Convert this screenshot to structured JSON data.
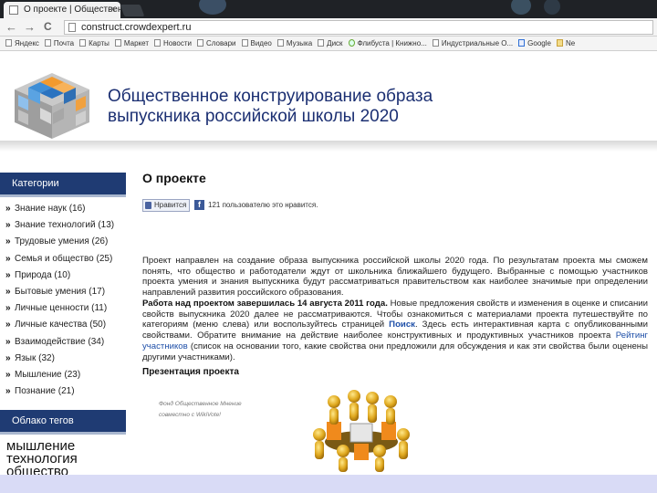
{
  "browser": {
    "tab_title": "О проекте | Общественн",
    "tab_close": "×",
    "url": "construct.crowdexpert.ru",
    "back": "←",
    "forward": "→",
    "reload": "C"
  },
  "bookmarks": [
    {
      "label": "Яндекс",
      "icon": "page-icon"
    },
    {
      "label": "Почта",
      "icon": "page-icon"
    },
    {
      "label": "Карты",
      "icon": "page-icon"
    },
    {
      "label": "Маркет",
      "icon": "page-icon"
    },
    {
      "label": "Новости",
      "icon": "page-icon"
    },
    {
      "label": "Словари",
      "icon": "page-icon"
    },
    {
      "label": "Видео",
      "icon": "page-icon"
    },
    {
      "label": "Музыка",
      "icon": "page-icon"
    },
    {
      "label": "Диск",
      "icon": "page-icon"
    },
    {
      "label": "Флибуста | Книжно...",
      "icon": "flibusta-icon"
    },
    {
      "label": "Индустриальные О...",
      "icon": "page-icon"
    },
    {
      "label": "Google",
      "icon": "google-icon"
    },
    {
      "label": "Ne",
      "icon": "folder-icon"
    }
  ],
  "site": {
    "title_line1": "Общественное конструирование образа",
    "title_line2": "выпускника российской школы 2020"
  },
  "sidebar": {
    "categories_heading": "Категории",
    "bullet": "»",
    "categories": [
      {
        "label": "Знание наук (16)"
      },
      {
        "label": "Знание технологий (13)"
      },
      {
        "label": "Трудовые умения (26)"
      },
      {
        "label": "Семья и общество (25)"
      },
      {
        "label": "Природа (10)"
      },
      {
        "label": "Бытовые умения (17)"
      },
      {
        "label": "Личные ценности (11)"
      },
      {
        "label": "Личные качества (50)"
      },
      {
        "label": "Взаимодействие (34)"
      },
      {
        "label": "Язык (32)"
      },
      {
        "label": "Мышление (23)"
      },
      {
        "label": "Познание (21)"
      }
    ],
    "tags_heading": "Облако тегов",
    "tags": [
      "мышление",
      "технология",
      "общество"
    ]
  },
  "main": {
    "page_title": "О проекте",
    "like_label": "Нравится",
    "fb_letter": "f",
    "like_count_text": "121 пользователю это нравится.",
    "para1": "Проект направлен на создание образа выпускника российской школы 2020 года. По результатам проекта мы сможем понять, что общество и работодатели ждут от школьника ближайшего будущего. Выбранные с помощью участников проекта умения и знания выпускника будут рассматриваться правительством как наиболее значимые при определении направлений развития российского образования.",
    "para2_bold": "Работа над проектом завершилась 14 августа 2011 года.",
    "para2_a": " Новые предложения свойств и изменения в оценке и списании свойств выпускника 2020 далее не рассматриваются. Чтобы ознакомиться с материалами проекта путешествуйте по категориям (меню слева) или воспользуйтесь страницей ",
    "para2_link1": "Поиск",
    "para2_b": ". Здесь есть интерактивная карта с опубликованными свойствами. Обратите внимание на действие наиболее конструктивных и продуктивных участников проекта ",
    "para2_link2": "Рейтинг участников",
    "para2_c": " (список на основании того, какие свойства они предложили для обсуждения и как эти свойства были оценены другими участниками).",
    "presentation_heading": "Презентация проекта",
    "credit_line1": "Фонд Общественное Мнение",
    "credit_line2": "совместно с WikiVote!"
  },
  "colors": {
    "sidebar_head": "#1f3b73",
    "title": "#1b2f72",
    "link": "#1e4fa8",
    "bottom_band": "#d9dbf6"
  }
}
